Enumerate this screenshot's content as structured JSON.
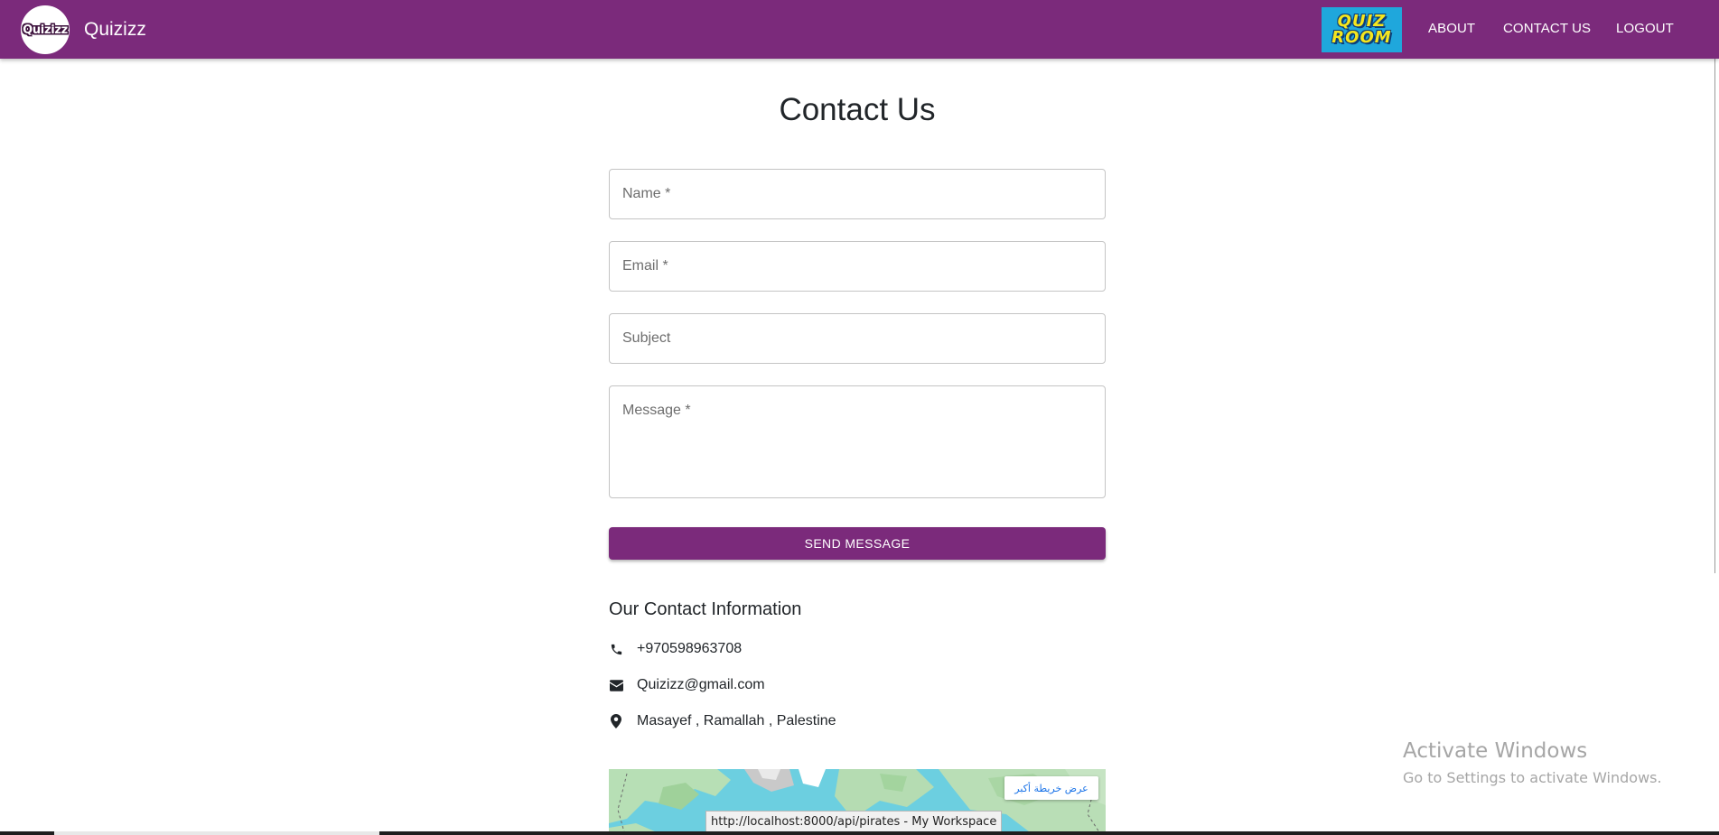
{
  "navbar": {
    "brand_logo_text": "Quizizz",
    "brand_name": "Quizizz",
    "quizroom_logo_line1": "QUIZ",
    "quizroom_logo_line2": "ROOM",
    "links": [
      {
        "label": "ABOUT"
      },
      {
        "label": "CONTACT US"
      },
      {
        "label": "LOGOUT"
      }
    ],
    "bg_color": "#7b2a7b"
  },
  "contact_form": {
    "title": "Contact Us",
    "name_placeholder": "Name *",
    "email_placeholder": "Email *",
    "subject_placeholder": "Subject",
    "message_placeholder": "Message *",
    "send_label": "SEND MESSAGE"
  },
  "contact_info": {
    "heading": "Our Contact Information",
    "phone": "+970598963708",
    "email": "Quizizz@gmail.com",
    "address": "Masayef , Ramallah , Palestine"
  },
  "map": {
    "view_larger_label": "عرض خريطة أكبر"
  },
  "status_bar": {
    "url_text": "http://localhost:8000/api/pirates - My Workspace"
  },
  "os_watermark": {
    "title": "Activate Windows",
    "subtitle": "Go to Settings to activate Windows."
  },
  "theme": {
    "accent": "#7b2a7b",
    "text": "#212529"
  }
}
